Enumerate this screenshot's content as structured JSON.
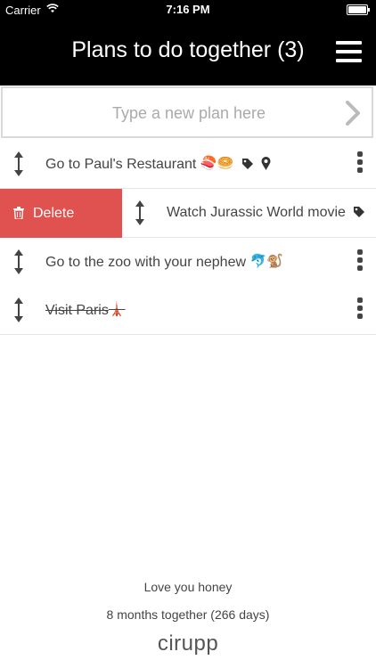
{
  "status_bar": {
    "carrier": "Carrier",
    "time": "7:16 PM"
  },
  "header": {
    "title": "Plans to do together (3)",
    "menu_icon": "hamburger-menu-icon"
  },
  "new_plan": {
    "placeholder": "Type a new plan here"
  },
  "plans": [
    {
      "label": "Go to Paul's Restaurant",
      "emoji": "🍣🥯",
      "done": false,
      "has_tag": true,
      "has_location": true
    },
    {
      "label": "Watch Jurassic World movie",
      "emoji": "",
      "done": false,
      "has_tag": true,
      "has_location": false,
      "swiped": true
    },
    {
      "label": "Go to the zoo with your nephew",
      "emoji": "🐬🐒",
      "done": false,
      "has_tag": false,
      "has_location": false
    },
    {
      "label": "Visit Paris",
      "emoji": "🗼",
      "done": true,
      "has_tag": false,
      "has_location": false
    }
  ],
  "swipe_action": {
    "label": "Delete",
    "color": "#e0524f"
  },
  "footer": {
    "message": "Love you honey",
    "duration": "8 months together (266 days)",
    "brand": "cirupp"
  }
}
